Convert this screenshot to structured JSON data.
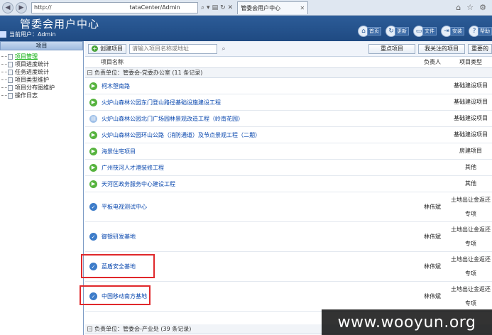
{
  "browser": {
    "address_prefix": "http://",
    "address_suffix": "tataCenter/Admin",
    "tab_title": "管委会用户中心"
  },
  "header": {
    "title": "管委会用户中心",
    "user_label": "当前用户：Admin",
    "toolbar": [
      {
        "icon": "home-icon",
        "label": "首页"
      },
      {
        "icon": "refresh-icon",
        "label": "更新"
      },
      {
        "icon": "folder-icon",
        "label": "文件"
      },
      {
        "icon": "exit-icon",
        "label": "安装"
      },
      {
        "icon": "help-icon",
        "label": "帮助"
      }
    ]
  },
  "sidebar": {
    "title": "项目",
    "items": [
      {
        "label": "项目管理",
        "active": true
      },
      {
        "label": "项目进度统计",
        "active": false
      },
      {
        "label": "任务进度统计",
        "active": false
      },
      {
        "label": "项目类型维护",
        "active": false
      },
      {
        "label": "项目分布图维护",
        "active": false
      },
      {
        "label": "操作日志",
        "active": false
      }
    ]
  },
  "main": {
    "create_label": "创建项目",
    "search_placeholder": "请输入项目名称或地址",
    "right_buttons": [
      "重点项目",
      "我关注的项目",
      "重要的"
    ],
    "columns": {
      "name": "项目名称",
      "owner": "负责人",
      "type": "项目类型"
    },
    "group1": "负责单位：管委会-党委办公室 (11 条记录)",
    "rows": [
      {
        "status": "play",
        "name": "柯木塱南路",
        "owner": "",
        "type": "基础建设项目",
        "tall": false
      },
      {
        "status": "play",
        "name": "火炉山森林公园东门登山路径基础设施建设工程",
        "owner": "",
        "type": "基础建设项目",
        "tall": false
      },
      {
        "status": "pause",
        "name": "火炉山森林公园北门广场园林景观改造工程（岭南花园）",
        "owner": "",
        "type": "基础建设项目",
        "tall": false
      },
      {
        "status": "play",
        "name": "火炉山森林公园环山公路（消防通道）及节点景观工程（二期）",
        "owner": "",
        "type": "基础建设项目",
        "tall": false
      },
      {
        "status": "play",
        "name": "海景住宅项目",
        "owner": "",
        "type": "房建项目",
        "tall": false
      },
      {
        "status": "play",
        "name": "广州筷河人才港装修工程",
        "owner": "",
        "type": "其他",
        "tall": false
      },
      {
        "status": "play",
        "name": "天河区政务服务中心建设工程",
        "owner": "",
        "type": "其他",
        "tall": false
      },
      {
        "status": "done",
        "name": "平板电视测试中心",
        "owner": "林伟斌",
        "type": "土地出让金返还专项",
        "tall": true
      },
      {
        "status": "done",
        "name": "御银研发基地",
        "owner": "林伟斌",
        "type": "土地出让金返还专项",
        "tall": true
      },
      {
        "status": "done",
        "name": "蓝盾安全基地",
        "owner": "林伟斌",
        "type": "土地出让金返还专项",
        "tall": true
      },
      {
        "status": "done",
        "name": "中国移动南方基地",
        "owner": "林伟斌",
        "type": "土地出让金返还专项",
        "tall": true
      }
    ],
    "group2": "负责单位：管委会-产业处 (39 条记录)"
  },
  "watermark": "www.wooyun.org",
  "colors": {
    "header": "#2c5c98",
    "highlight": "#e0282b",
    "link": "#0645ad"
  }
}
